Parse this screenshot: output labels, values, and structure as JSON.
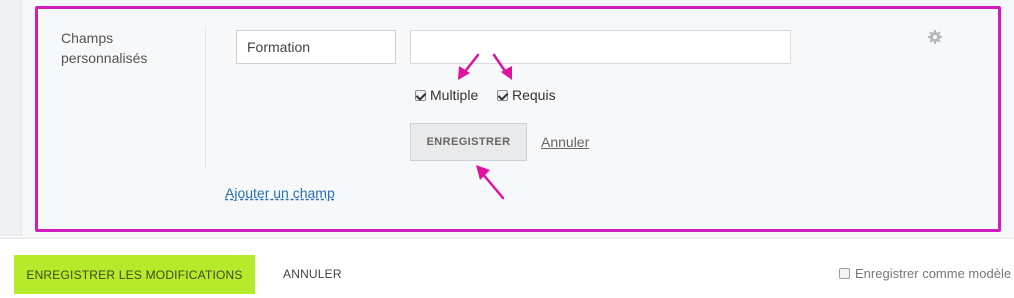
{
  "field": {
    "section_label": "Champs personnalisés",
    "name_value": "Formation",
    "value_placeholder": "",
    "options": [
      {
        "label": "Multiple",
        "checked": true
      },
      {
        "label": "Requis",
        "checked": true
      }
    ],
    "save_label": "ENREGISTRER",
    "cancel_label": "Annuler",
    "add_field_label": "Ajouter un champ",
    "settings_icon": "gear-icon"
  },
  "footer": {
    "save_changes_label": "ENREGISTRER LES MODIFICATIONS",
    "cancel_label": "ANNULER",
    "save_template_label": "Enregistrer comme modèle",
    "save_template_checked": false
  },
  "colors": {
    "highlight": "#d21dbe",
    "primary": "#b8ea2c",
    "link": "#2a6fb0"
  }
}
